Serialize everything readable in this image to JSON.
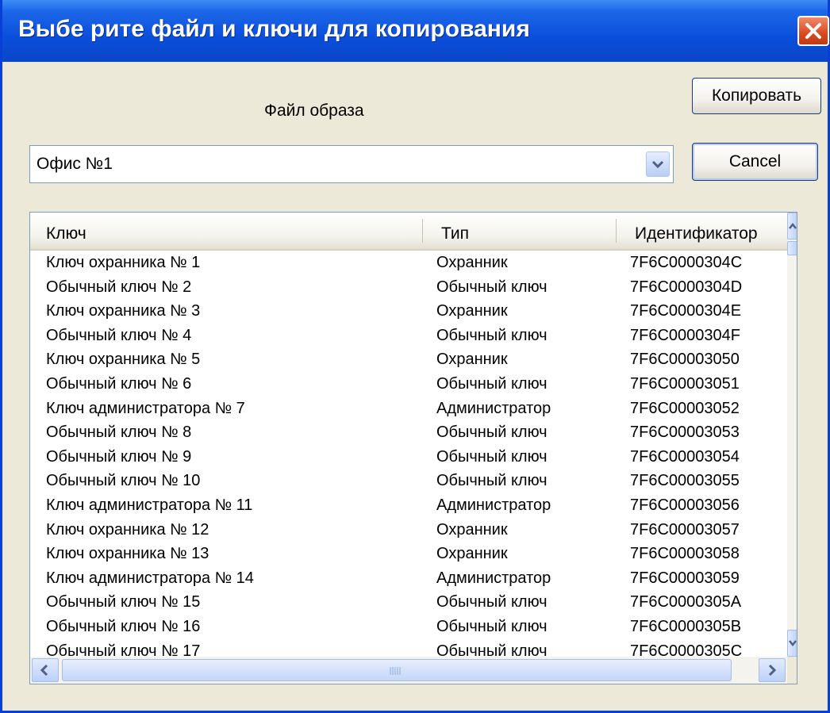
{
  "window": {
    "title": "Выбе рите файл и ключи для копирования",
    "close_icon": "close-x-icon"
  },
  "form": {
    "file_label": "Файл образа",
    "file_select_value": "Офис №1",
    "copy_button": "Копировать",
    "cancel_button": "Cancel"
  },
  "table": {
    "columns": [
      "Ключ",
      "Тип",
      "Идентификатор"
    ],
    "rows": [
      [
        "Ключ охранника № 1",
        "Охранник",
        "7F6C0000304C"
      ],
      [
        "Обычный ключ № 2",
        "Обычный ключ",
        "7F6C0000304D"
      ],
      [
        "Ключ охранника № 3",
        "Охранник",
        "7F6C0000304E"
      ],
      [
        "Обычный ключ № 4",
        "Обычный ключ",
        "7F6C0000304F"
      ],
      [
        "Ключ охранника № 5",
        "Охранник",
        "7F6C00003050"
      ],
      [
        "Обычный ключ № 6",
        "Обычный ключ",
        "7F6C00003051"
      ],
      [
        "Ключ администратора № 7",
        "Администратор",
        "7F6C00003052"
      ],
      [
        "Обычный ключ № 8",
        "Обычный ключ",
        "7F6C00003053"
      ],
      [
        "Обычный ключ № 9",
        "Обычный ключ",
        "7F6C00003054"
      ],
      [
        "Обычный ключ № 10",
        "Обычный ключ",
        "7F6C00003055"
      ],
      [
        "Ключ администратора № 11",
        "Администратор",
        "7F6C00003056"
      ],
      [
        "Ключ охранника № 12",
        "Охранник",
        "7F6C00003057"
      ],
      [
        "Ключ охранника № 13",
        "Охранник",
        "7F6C00003058"
      ],
      [
        "Ключ администратора № 14",
        "Администратор",
        "7F6C00003059"
      ],
      [
        "Обычный ключ № 15",
        "Обычный ключ",
        "7F6C0000305A"
      ],
      [
        "Обычный ключ № 16",
        "Обычный ключ",
        "7F6C0000305B"
      ],
      [
        "Обычный ключ № 17",
        "Обычный ключ",
        "7F6C0000305C"
      ]
    ]
  },
  "icons": {
    "dropdown": "chevron-down-icon",
    "scroll_up": "scroll-up-arrow-icon",
    "scroll_down": "scroll-down-arrow-icon",
    "scroll_left": "scroll-left-arrow-icon",
    "scroll_right": "scroll-right-arrow-icon"
  },
  "colors": {
    "titlebar": "#0a4fdb",
    "dialog_bg": "#ece9d8",
    "close_button": "#d94a1f"
  }
}
